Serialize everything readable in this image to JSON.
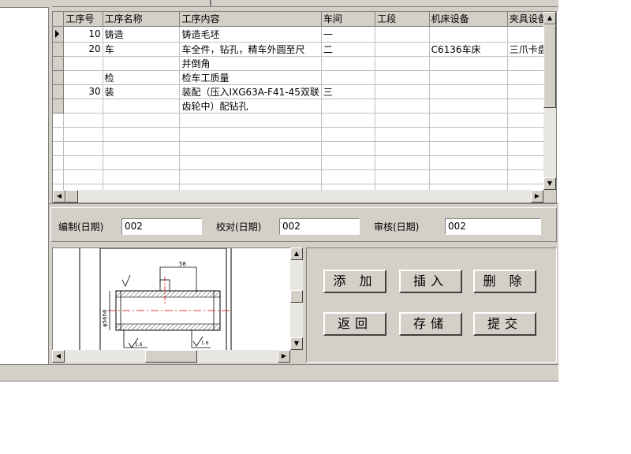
{
  "grid": {
    "columns": [
      "工序号",
      "工序名称",
      "工序内容",
      "车间",
      "工段",
      "机床设备",
      "夹具设备"
    ],
    "rows": [
      {
        "no": "10",
        "name": "铸造",
        "content": "铸造毛坯",
        "workshop": "一",
        "section": "",
        "machine": "",
        "fixture": ""
      },
      {
        "no": "20",
        "name": "车",
        "content": "车全件，钻孔，精车外圆至尺",
        "workshop": "二",
        "section": "",
        "machine": "C6136车床",
        "fixture": "三爪卡盘"
      },
      {
        "no": "",
        "name": "",
        "content": "并倒角",
        "workshop": "",
        "section": "",
        "machine": "",
        "fixture": ""
      },
      {
        "no": "",
        "name": "检",
        "content": "检车工质量",
        "workshop": "",
        "section": "",
        "machine": "",
        "fixture": ""
      },
      {
        "no": "30",
        "name": "装",
        "content": "装配（压入IXG63A-F41-45双联",
        "workshop": "三",
        "section": "",
        "machine": "",
        "fixture": ""
      },
      {
        "no": "",
        "name": "",
        "content": "齿轮中）配钻孔",
        "workshop": "",
        "section": "",
        "machine": "",
        "fixture": ""
      }
    ]
  },
  "signoff": {
    "compile_label": "编制(日期)",
    "compile_value": "002",
    "proofread_label": "校对(日期)",
    "proofread_value": "002",
    "review_label": "审核(日期)",
    "review_value": "002"
  },
  "buttons": {
    "add": "添 加",
    "insert": "插入",
    "delete": "删 除",
    "back": "返回",
    "save": "存储",
    "submit": "提交"
  },
  "drawing": {
    "dim_top": "58",
    "dim_left": "φ56h6",
    "ra1": "1.6",
    "ra2": "1.6"
  },
  "colors": {
    "face": "#d4d0c8",
    "centerline": "#e00000"
  }
}
